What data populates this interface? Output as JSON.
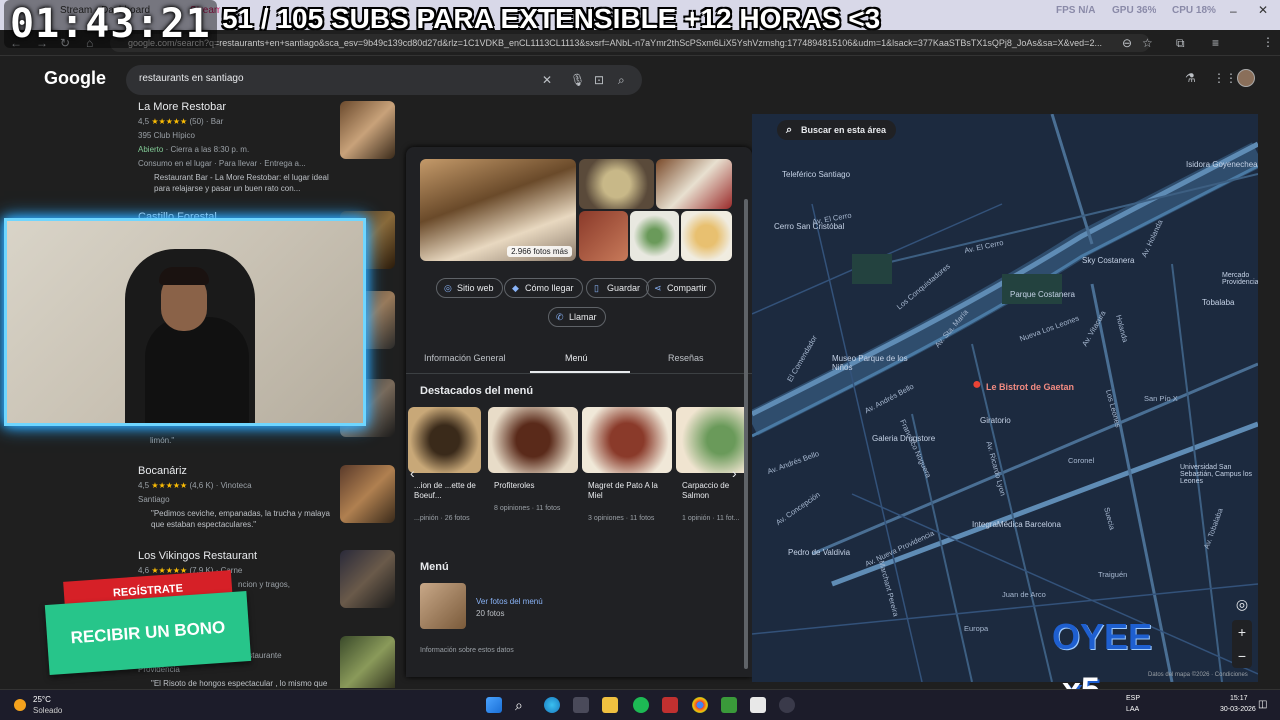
{
  "stream": {
    "timer": "01:43:21",
    "subs_banner": "51 / 105 SUBS PARA EXTENSIBLE +12 HORAS <3"
  },
  "browser": {
    "tabs": [
      "Stream - Dashboard",
      "Stream"
    ],
    "stats": {
      "fps": "FPS N/A",
      "gpu": "GPU 36%",
      "cpu": "CPU 18%"
    },
    "url": "google.com/search?q=restaurants+en+santiago&sca_esv=9b49c139cd80d27d&rlz=1C1VDKB_enCL1113CL1113&sxsrf=ANbL-n7aYmr2thScPSxm6LiX5YshVzmshg:1774894815106&udm=1&lsack=377KaaSTBsTX1sQPj8_JoAs&sa=X&ved=2..."
  },
  "google": {
    "logo": "Google",
    "query": "restaurants en santiago"
  },
  "results": [
    {
      "name": "La More Restobar",
      "rating": "4,5",
      "reviews": "(50)",
      "category": "Bar",
      "address": "395 Club Hípico",
      "status": "Abierto",
      "hours": "Cierra a las 8:30 p. m.",
      "services": "Consumo en el lugar · Para llevar · Entrega a...",
      "snippet": "Restaurant Bar - La More Restobar: el lugar ideal para relajarse y pasar un buen rato con..."
    },
    {
      "name": "Castillo Forestal",
      "snippet": "limón.\""
    },
    {
      "name": "Bocanáriz",
      "rating": "4,5",
      "reviews": "(4,6 K)",
      "category": "Vinoteca",
      "address": "Santiago",
      "snippet": "\"Pedimos ceviche, empanadas, la trucha y malaya que estaban espectaculares.\""
    },
    {
      "name": "Los Vikingos Restaurant",
      "rating": "4,6",
      "reviews": "(7,9 K)",
      "category": "Carne",
      "snippet": "ncion y tragos,"
    },
    {
      "name": "Restaurante",
      "address": "Providencia",
      "snippet": "\"El Risoto de hongos espectacular , lo mismo que"
    }
  ],
  "promo": {
    "register": "REGÍSTRATE",
    "bonus": "RECIBIR UN BONO"
  },
  "panel": {
    "photos_more": "2.966 fotos más",
    "actions": [
      "Sitio web",
      "Cómo llegar",
      "Guardar",
      "Compartir",
      "Llamar"
    ],
    "tabs": [
      "Información General",
      "Menú",
      "Reseñas"
    ],
    "active_tab": "Menú",
    "highlights_title": "Destacados del menú",
    "dishes": [
      {
        "name": "...ion de ...ette de Boeuf...",
        "meta": "...pinión · 26 fotos"
      },
      {
        "name": "Profiteroles",
        "meta": "8 opiniones · 11 fotos"
      },
      {
        "name": "Magret de Pato A la Miel",
        "meta": "3 opiniones · 11 fotos"
      },
      {
        "name": "Carpaccio de Salmon",
        "meta": "1 opinión · 11 fot..."
      }
    ],
    "menu_title": "Menú",
    "menu_link": "Ver fotos del menú",
    "menu_count": "20 fotos",
    "data_info": "Información sobre estos datos"
  },
  "map": {
    "search_area": "Buscar en esta área",
    "pin": "Le Bistrot de Gaetan",
    "places": [
      "Cerro San Cristóbal",
      "Sky Costanera",
      "Tobalaba",
      "Parque Costanera",
      "Museo Parque de los Niños",
      "Giratorio",
      "Galeria Drugstore",
      "IntegraMédica Barcelona",
      "Pedro de Valdivia",
      "Universidad San Sebastián, Campus los Leones",
      "Mercado Providencia",
      "Teleférico Santiago",
      "Isidora Goyenechea"
    ],
    "streets": [
      "Av. El Cerro",
      "Av. El Cerro",
      "Los Conquistadores",
      "Av. Sta. María",
      "Nueva Los Leones",
      "Av. Andrés Bello",
      "Av. Andrés Bello",
      "Av. Nueva Providencia",
      "Av. Ricardo Lyon",
      "Av. Vitacura",
      "Holanda",
      "San Pío X",
      "Av. Concepción",
      "Coronel",
      "Suecia",
      "Los Leones",
      "Europa",
      "Juan de Arco",
      "Traiguén",
      "El Comendador",
      "Francisco Noguera",
      "Marchant Pereira",
      "Av. Holanda",
      "Av. Tobalaba"
    ],
    "attribution": "Datos del mapa ©2026 · Condiciones"
  },
  "watermark": {
    "oyee": "OYEE",
    "x5": "x5"
  },
  "taskbar": {
    "weather_temp": "25°C",
    "weather_desc": "Soleado",
    "lang": "ESP",
    "lang2": "LAA",
    "time": "15:17",
    "date": "30-03-2026"
  }
}
